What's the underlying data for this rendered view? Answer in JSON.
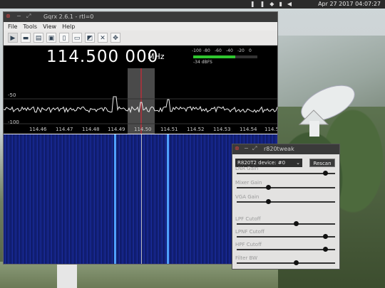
{
  "panel": {
    "tray_icons": [
      "pause-icon",
      "wifi-icon",
      "battery-icon",
      "volume-icon"
    ],
    "clock": "Apr 27 2017 04:07:27"
  },
  "gqrx": {
    "title": "Gqrx 2.6.1 - rtl=0",
    "menu": [
      "File",
      "Tools",
      "View",
      "Help"
    ],
    "toolbar_icons": [
      "play-icon",
      "device-icon",
      "folder-icon",
      "save-icon",
      "document-icon",
      "screen-icon",
      "chip-icon",
      "tools-icon",
      "crosshair-icon"
    ],
    "frequency": "114.500 000",
    "frequency_unit": "MHz",
    "meter_scale": [
      "-100",
      "-80",
      "-60",
      "-40",
      "-20",
      "0"
    ],
    "meter_value": "-34 dBFS",
    "meter_level": 0.66,
    "spectrum_ylabels": [
      "-50",
      "-100"
    ],
    "spectrum_xlabels": [
      "114.46",
      "114.47",
      "114.48",
      "114.49",
      "114.50",
      "114.51",
      "114.52",
      "114.53",
      "114.54",
      "114.5"
    ]
  },
  "tweak": {
    "title": "r820tweak",
    "device": "R820T2 device: #0",
    "rescan": "Rescan",
    "sliders": [
      {
        "label": "LNA Gain",
        "value": 0.9
      },
      {
        "label": "Mixer Gain",
        "value": 0.32
      },
      {
        "label": "VGA Gain",
        "value": 0.32
      },
      {
        "label": "LPF Cutoff",
        "value": 0.6
      },
      {
        "label": "LPNF Cutoff",
        "value": 0.9
      },
      {
        "label": "HPF Cutoff",
        "value": 0.9
      },
      {
        "label": "Filter BW",
        "value": 0.6
      }
    ]
  }
}
